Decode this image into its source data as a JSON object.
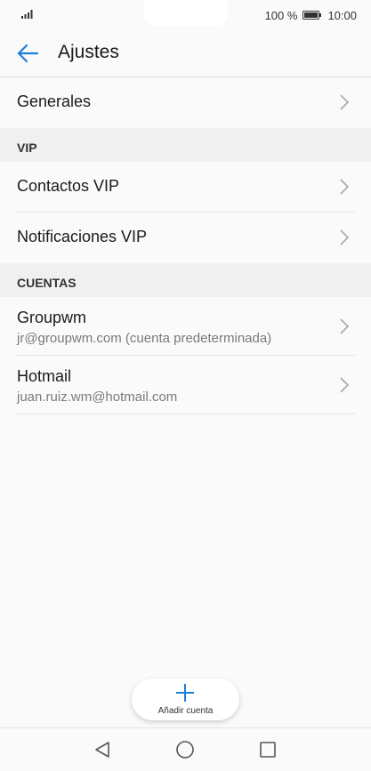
{
  "status_bar": {
    "battery_text": "100 %",
    "time": "10:00",
    "icons": [
      "signal-icon",
      "battery-icon"
    ]
  },
  "app_bar": {
    "title": "Ajustes",
    "back_icon": "arrow-left-icon"
  },
  "sections": {
    "general": {
      "item": {
        "title": "Generales"
      }
    },
    "vip": {
      "header": "VIP",
      "items": [
        {
          "title": "Contactos VIP"
        },
        {
          "title": "Notificaciones VIP"
        }
      ]
    },
    "accounts": {
      "header": "CUENTAS",
      "items": [
        {
          "title": "Groupwm",
          "subtitle": "jr@groupwm.com (cuenta predeterminada)"
        },
        {
          "title": "Hotmail",
          "subtitle": "juan.ruiz.wm@hotmail.com"
        }
      ]
    }
  },
  "fab": {
    "label": "Añadir cuenta",
    "icon": "plus-icon"
  },
  "nav_bar": {
    "icons": [
      "back-triangle-icon",
      "home-circle-icon",
      "recents-square-icon"
    ]
  },
  "colors": {
    "accent": "#1e7ed8",
    "background": "#fafafa",
    "section_bg": "#f0f0f0",
    "subtitle": "#7a7a7a"
  }
}
